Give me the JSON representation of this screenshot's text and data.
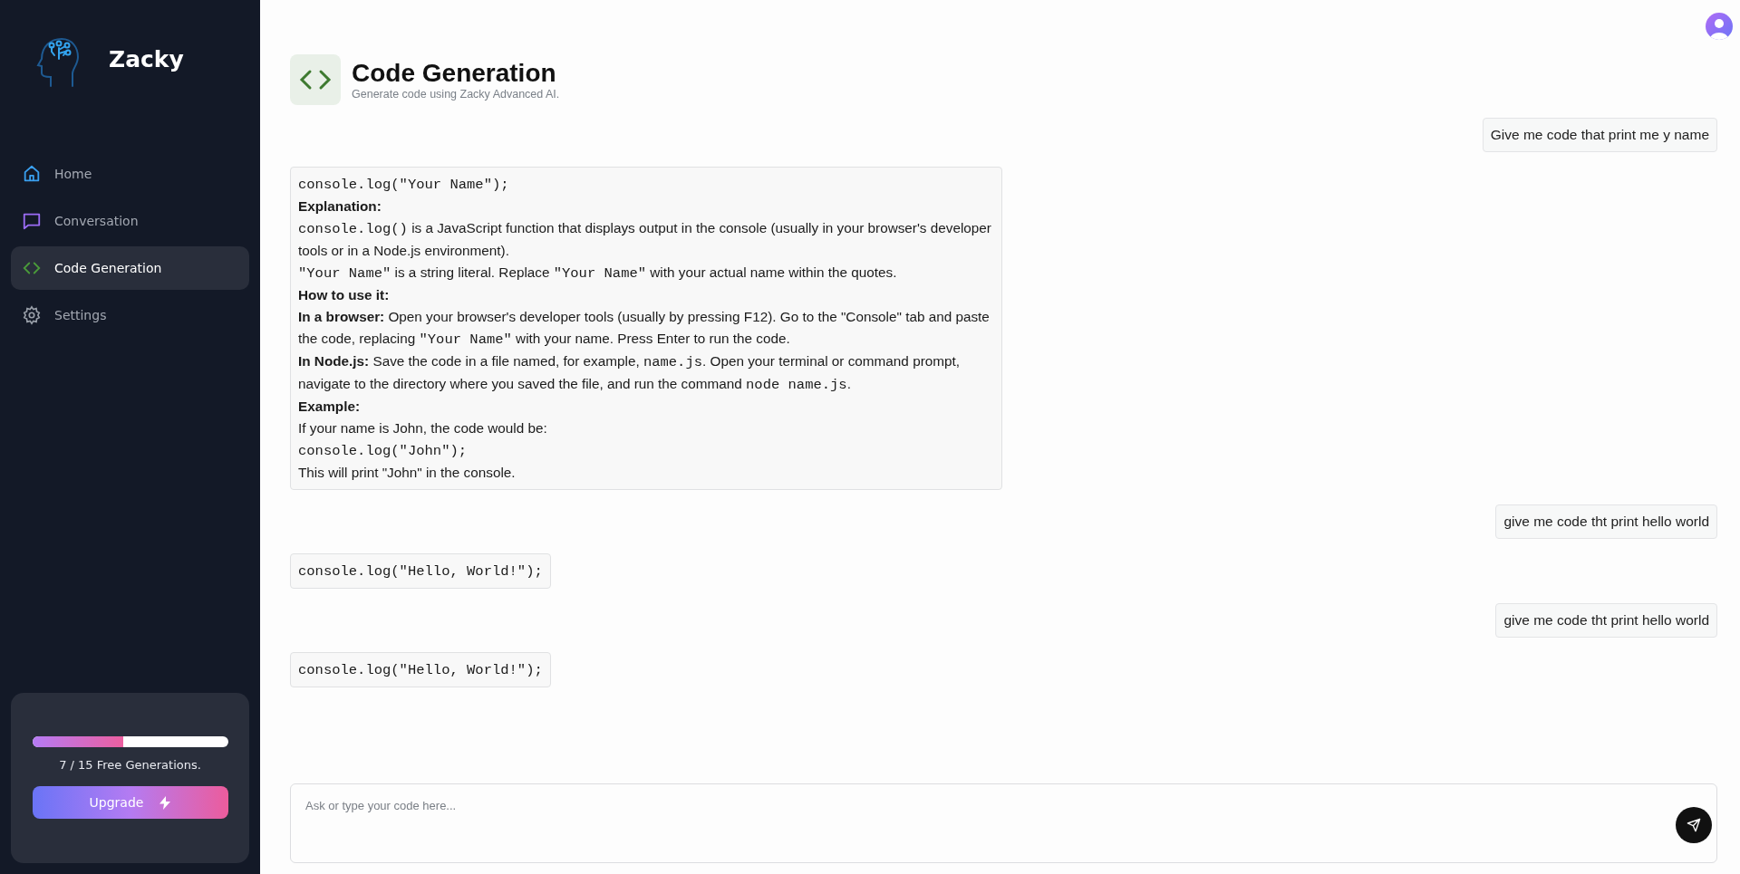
{
  "brand": {
    "name": "Zacky"
  },
  "sidebar": {
    "items": [
      {
        "label": "Home",
        "kind": "home",
        "selected": false
      },
      {
        "label": "Conversation",
        "kind": "chat",
        "selected": false
      },
      {
        "label": "Code Generation",
        "kind": "code",
        "selected": true
      },
      {
        "label": "Settings",
        "kind": "settings",
        "selected": false
      }
    ]
  },
  "usage": {
    "level": 0.467,
    "text": "7 / 15 Free Generations.",
    "button": "Upgrade"
  },
  "header": {
    "title": "Code Generation",
    "subtitle": "Generate code using Zacky Advanced AI."
  },
  "messages": [
    {
      "kind": "user",
      "text": "Give me code that print me y name"
    },
    {
      "kind": "bot",
      "lines": [
        [
          {
            "kind": "code",
            "text": "console.log(\"Your Name\");"
          }
        ],
        [
          {
            "kind": "bold",
            "text": "Explanation:"
          }
        ],
        [
          {
            "kind": "code",
            "text": "console.log()"
          },
          {
            "kind": "text",
            "text": " is a JavaScript function that displays output in the console (usually in your browser's developer tools or in a Node.js environment)."
          }
        ],
        [
          {
            "kind": "code",
            "text": "\"Your Name\""
          },
          {
            "kind": "text",
            "text": " is a string literal. Replace "
          },
          {
            "kind": "code",
            "text": "\"Your Name\""
          },
          {
            "kind": "text",
            "text": " with your actual name within the quotes."
          }
        ],
        [
          {
            "kind": "bold",
            "text": "How to use it:"
          }
        ],
        [
          {
            "kind": "bold",
            "text": "In a browser:"
          },
          {
            "kind": "text",
            "text": " Open your browser's developer tools (usually by pressing F12). Go to the \"Console\" tab and paste the code, replacing "
          },
          {
            "kind": "code",
            "text": "\"Your Name\""
          },
          {
            "kind": "text",
            "text": " with your name. Press Enter to run the code."
          }
        ],
        [
          {
            "kind": "bold",
            "text": "In Node.js:"
          },
          {
            "kind": "text",
            "text": " Save the code in a file named, for example, "
          },
          {
            "kind": "code",
            "text": "name.js"
          },
          {
            "kind": "text",
            "text": ". Open your terminal or command prompt, navigate to the directory where you saved the file, and run the command "
          },
          {
            "kind": "code",
            "text": "node name.js"
          },
          {
            "kind": "text",
            "text": "."
          }
        ],
        [
          {
            "kind": "bold",
            "text": "Example:"
          }
        ],
        [
          {
            "kind": "text",
            "text": "If your name is John, the code would be:"
          }
        ],
        [
          {
            "kind": "code",
            "text": "console.log(\"John\");"
          }
        ],
        [
          {
            "kind": "text",
            "text": "This will print \"John\" in the console."
          }
        ]
      ]
    },
    {
      "kind": "user",
      "text": "give me code tht print hello world"
    },
    {
      "kind": "bot",
      "lines": [
        [
          {
            "kind": "code",
            "text": "console.log(\"Hello, World!\");"
          }
        ]
      ]
    },
    {
      "kind": "user",
      "text": "give me code tht print hello world"
    },
    {
      "kind": "bot",
      "lines": [
        [
          {
            "kind": "code",
            "text": "console.log(\"Hello, World!\");"
          }
        ]
      ]
    }
  ],
  "composer": {
    "placeholder": "Ask or type your code here..."
  }
}
